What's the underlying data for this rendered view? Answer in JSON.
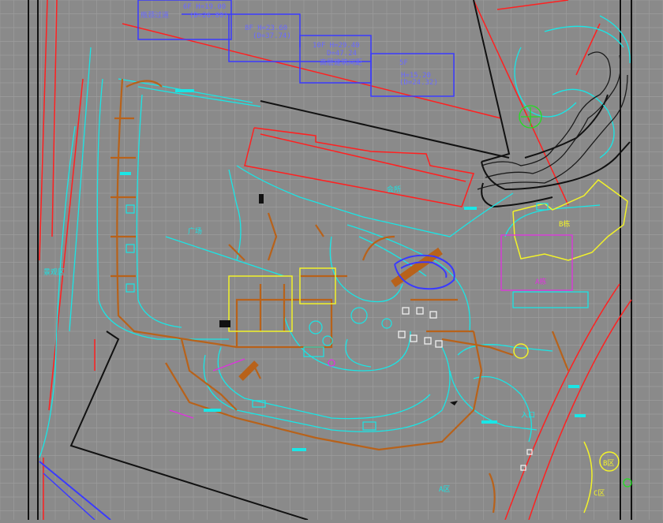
{
  "viewport": {
    "background": "#8a8a8a"
  },
  "colors": {
    "grid": "#9c9c9c",
    "frame": "#111111",
    "red": "#ff2020",
    "cyan": "#19e6e6",
    "brown": "#b8621a",
    "blue": "#3a3aff",
    "yellow": "#f2f22a",
    "magenta": "#e030e0",
    "white": "#f0f0f0",
    "green": "#20e020",
    "orange": "#e08a20"
  },
  "labels": {
    "bldg_a": "6F H=19.00",
    "bldg_a_d": "(D=26.80)",
    "bldg_a_note": "瓶颈过道",
    "bldg_b": "8F H=23.60",
    "bldg_b_d": "(D=37.74)",
    "bldg_c": "10F H=29.40",
    "bldg_c_d": "D=47.24",
    "bldg_c_note": "高层建筑间距",
    "bldg_d": "5F",
    "bldg_d_h": "H=15.20",
    "bldg_d_d": "(D=24.32)",
    "zone_left": "景观区",
    "zone_clubhouse": "会所",
    "zone_right1": "B栋",
    "zone_right2": "A栋",
    "zone_bottom": "A区",
    "zone_br": "B区",
    "zone_br2": "C区",
    "plaza": "广场",
    "entrance": "入口"
  }
}
